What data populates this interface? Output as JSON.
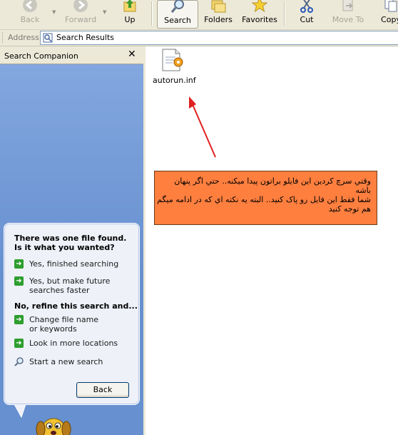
{
  "toolbar": {
    "back_label": "Back",
    "forward_label": "Forward",
    "up_label": "Up",
    "search_label": "Search",
    "folders_label": "Folders",
    "favorites_label": "Favorites",
    "cut_label": "Cut",
    "move_to_label": "Move To",
    "copy_label": "Copy"
  },
  "address": {
    "label": "Address",
    "value": "Search Results"
  },
  "companion": {
    "title": "Search Companion",
    "question1": "There was one file found.  Is it what you wanted?",
    "option_finished": "Yes, finished searching",
    "option_future": "Yes, but make future searches faster",
    "question2": "No, refine this search and...",
    "option_change": "Change file name or keywords",
    "option_more_locations": "Look in more locations",
    "option_new_search": "Start a new search",
    "back_button": "Back"
  },
  "results": {
    "file_name": "autorun.inf"
  },
  "annotation": {
    "text": "وقتي سرچ کردين اين فايلو براتون پيدا ميکنه.. حتي اگر پنهان باشه\nشما فقط اين فايل رو پاک کنيد.. البته يه نکته اي که در ادامه ميگم هم توجه کنيد"
  },
  "colors": {
    "toolbar_bg": "#ece9d8",
    "pane_bg": "#6e94ce",
    "note_bg": "#ff7f3f",
    "arrow_red": "#e02020"
  }
}
